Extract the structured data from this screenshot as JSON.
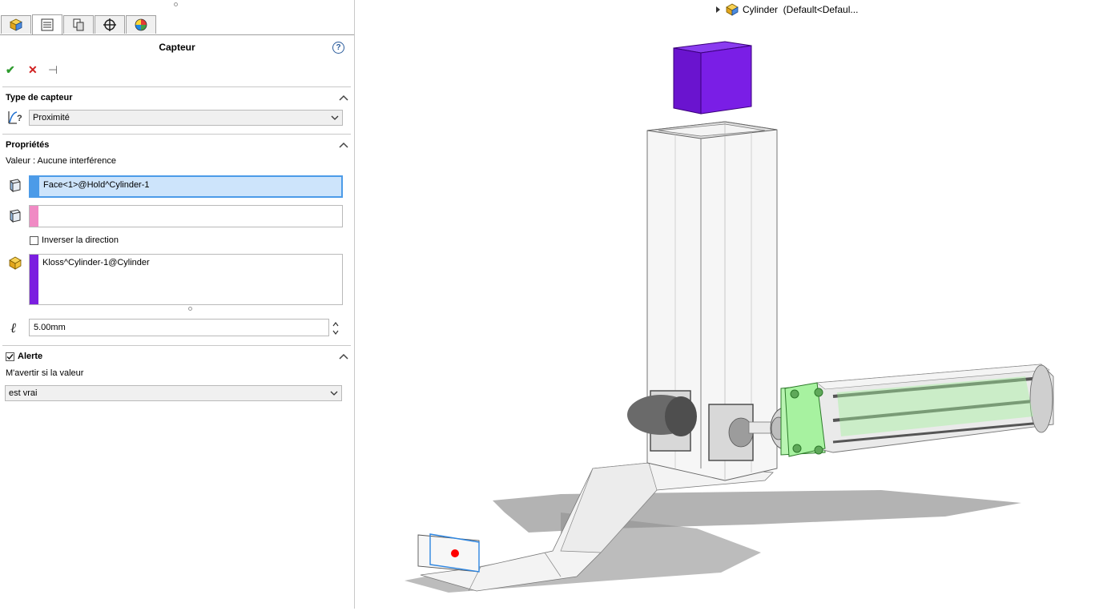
{
  "tabs": [
    {
      "name": "feature-manager",
      "icon": "cube-icon"
    },
    {
      "name": "property-manager",
      "icon": "list-icon",
      "active": true
    },
    {
      "name": "configuration-manager",
      "icon": "config-icon"
    },
    {
      "name": "dimxpert-manager",
      "icon": "crosshair-icon"
    },
    {
      "name": "display-manager",
      "icon": "color-wheel-icon"
    }
  ],
  "panel": {
    "title": "Capteur",
    "help": "?",
    "actions": {
      "ok": "✔",
      "cancel": "✕",
      "pin": "⊣"
    },
    "sensor_type": {
      "header": "Type de capteur",
      "value": "Proximité"
    },
    "properties": {
      "header": "Propriétés",
      "valeur": "Valeur : Aucune interférence",
      "face_selection": "Face<1>@Hold^Cylinder-1",
      "second_selection": "",
      "reverse_label": "Inverser la direction",
      "reverse_checked": false,
      "component_selection": "Kloss^Cylinder-1@Cylinder",
      "distance": "5.00mm"
    },
    "alert": {
      "header": "Alerte",
      "checked": true,
      "prompt": "M'avertir si la valeur",
      "condition": "est vrai"
    }
  },
  "tree": {
    "label": "Cylinder  (Default<Defaul..."
  },
  "colors": {
    "face_bar": "#4c9be8",
    "second_bar": "#f08ac4",
    "component_bar": "#7b1fe0",
    "cube": "#7a1ee6",
    "cylinder_green": "#a7f2a0"
  }
}
